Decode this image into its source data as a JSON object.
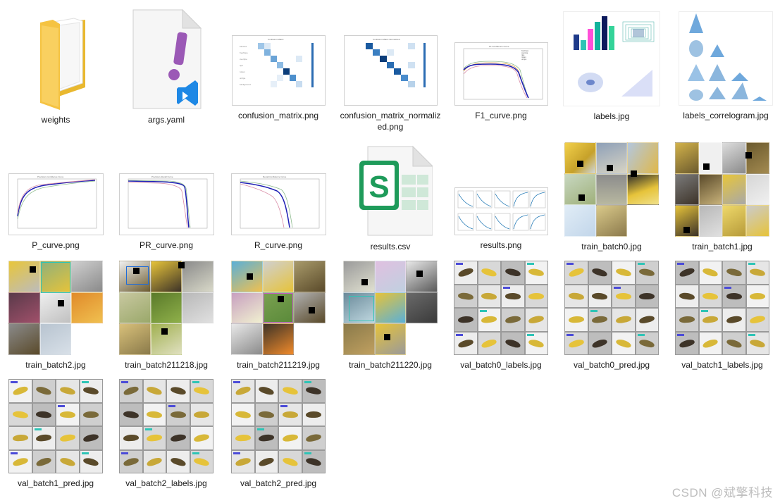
{
  "files": [
    {
      "id": "weights",
      "name": "weights",
      "kind": "folder",
      "icon": "folder-icon"
    },
    {
      "id": "args",
      "name": "args.yaml",
      "kind": "yaml",
      "icon": "vscode-yaml-icon"
    },
    {
      "id": "cm",
      "name": "confusion_matrix.png",
      "kind": "matrix",
      "icon": "image-thumbnail"
    },
    {
      "id": "cmn",
      "name": "confusion_matrix_normalized.png",
      "kind": "matrix",
      "icon": "image-thumbnail"
    },
    {
      "id": "f1",
      "name": "F1_curve.png",
      "kind": "curve",
      "icon": "image-thumbnail"
    },
    {
      "id": "labels",
      "name": "labels.jpg",
      "kind": "labels",
      "icon": "image-thumbnail"
    },
    {
      "id": "corr",
      "name": "labels_correlogram.jpg",
      "kind": "correlogram",
      "icon": "image-thumbnail"
    },
    {
      "id": "p",
      "name": "P_curve.png",
      "kind": "curve",
      "icon": "image-thumbnail"
    },
    {
      "id": "pr",
      "name": "PR_curve.png",
      "kind": "curve",
      "icon": "image-thumbnail"
    },
    {
      "id": "r",
      "name": "R_curve.png",
      "kind": "curve",
      "icon": "image-thumbnail"
    },
    {
      "id": "csv",
      "name": "results.csv",
      "kind": "csv",
      "icon": "spreadsheet-icon"
    },
    {
      "id": "res",
      "name": "results.png",
      "kind": "results",
      "icon": "image-thumbnail"
    },
    {
      "id": "tb0",
      "name": "train_batch0.jpg",
      "kind": "batch",
      "icon": "image-thumbnail"
    },
    {
      "id": "tb1",
      "name": "train_batch1.jpg",
      "kind": "batch",
      "icon": "image-thumbnail"
    },
    {
      "id": "tb2",
      "name": "train_batch2.jpg",
      "kind": "batch",
      "icon": "image-thumbnail"
    },
    {
      "id": "tb218",
      "name": "train_batch211218.jpg",
      "kind": "batch",
      "icon": "image-thumbnail"
    },
    {
      "id": "tb219",
      "name": "train_batch211219.jpg",
      "kind": "batch",
      "icon": "image-thumbnail"
    },
    {
      "id": "tb220",
      "name": "train_batch211220.jpg",
      "kind": "batch",
      "icon": "image-thumbnail"
    },
    {
      "id": "v0l",
      "name": "val_batch0_labels.jpg",
      "kind": "val",
      "icon": "image-thumbnail"
    },
    {
      "id": "v0p",
      "name": "val_batch0_pred.jpg",
      "kind": "val",
      "icon": "image-thumbnail"
    },
    {
      "id": "v1l",
      "name": "val_batch1_labels.jpg",
      "kind": "val",
      "icon": "image-thumbnail"
    },
    {
      "id": "v1p",
      "name": "val_batch1_pred.jpg",
      "kind": "val",
      "icon": "image-thumbnail"
    },
    {
      "id": "v2l",
      "name": "val_batch2_labels.jpg",
      "kind": "val",
      "icon": "image-thumbnail"
    },
    {
      "id": "v2p",
      "name": "val_batch2_pred.jpg",
      "kind": "val",
      "icon": "image-thumbnail"
    }
  ],
  "csv_letter": "S",
  "yaml_glyph": "!",
  "watermark": "CSDN @斌擎科技",
  "colors": {
    "folder": "#f5c342",
    "csv_green": "#1e9b5a",
    "yaml_purple": "#9b59b6",
    "vscode_blue": "#1e88e5",
    "banana_yellow": "#e8c63a",
    "banana_dark": "#5a4a2a",
    "bbox_blue": "#1e6bd9"
  }
}
